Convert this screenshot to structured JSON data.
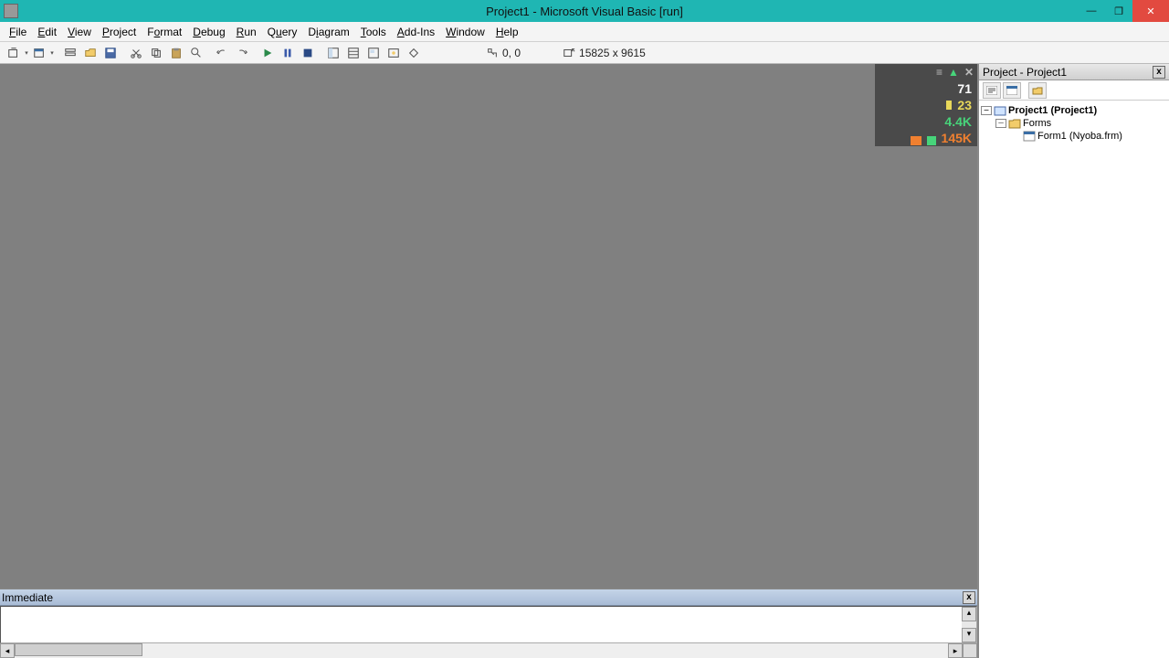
{
  "titlebar": {
    "title": "Project1 - Microsoft Visual Basic [run]"
  },
  "menus": [
    "File",
    "Edit",
    "View",
    "Project",
    "Format",
    "Debug",
    "Run",
    "Query",
    "Diagram",
    "Tools",
    "Add-Ins",
    "Window",
    "Help"
  ],
  "toolbar": {
    "pos_label": "0, 0",
    "size_label": "15825 x 9615"
  },
  "overlay": {
    "v1": "71",
    "v2": "23",
    "v3": "4.4K",
    "v4": "145K"
  },
  "immediate": {
    "title": "Immediate"
  },
  "project_explorer": {
    "title": "Project - Project1",
    "root": "Project1 (Project1)",
    "folder": "Forms",
    "form": "Form1 (Nyoba.frm)"
  }
}
